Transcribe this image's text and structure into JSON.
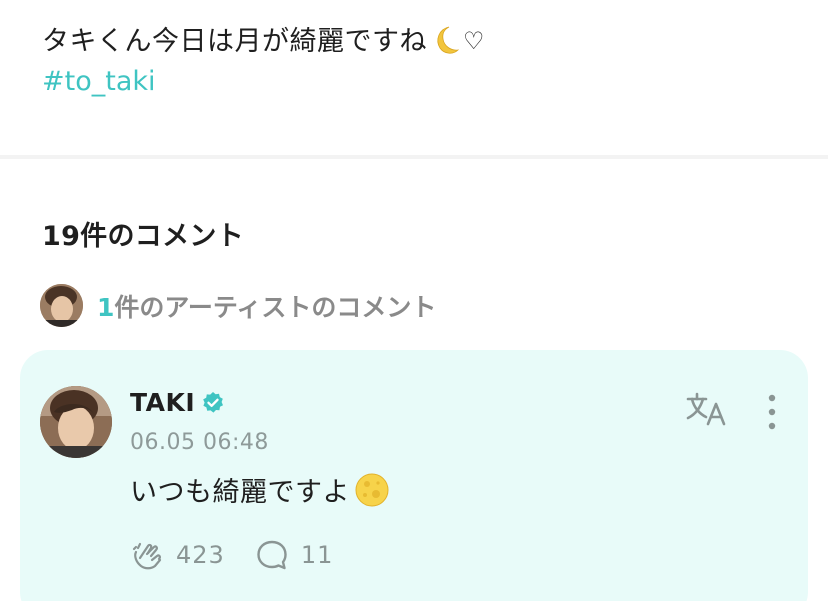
{
  "post": {
    "text": "タキくん今日は月が綺麗ですね",
    "heart": "♡",
    "hashtag": "#to_taki"
  },
  "comments": {
    "title": "19件のコメント",
    "artist_count": "1",
    "artist_label": "件のアーティストのコメント"
  },
  "comment": {
    "author": "TAKI",
    "timestamp": "06.05 06:48",
    "text": "いつも綺麗ですよ",
    "likes": "423",
    "replies": "11"
  },
  "icons": {
    "moon": "crescent-moon-emoji",
    "full_moon": "full-moon-emoji",
    "verified": "verified-badge",
    "translate": "translate-icon",
    "more": "more-vertical-icon",
    "like": "like-hands-icon",
    "reply": "speech-bubble-icon"
  },
  "colors": {
    "accent": "#3fc4c2",
    "card_bg": "#e8fbf9",
    "muted": "#8a9594"
  }
}
